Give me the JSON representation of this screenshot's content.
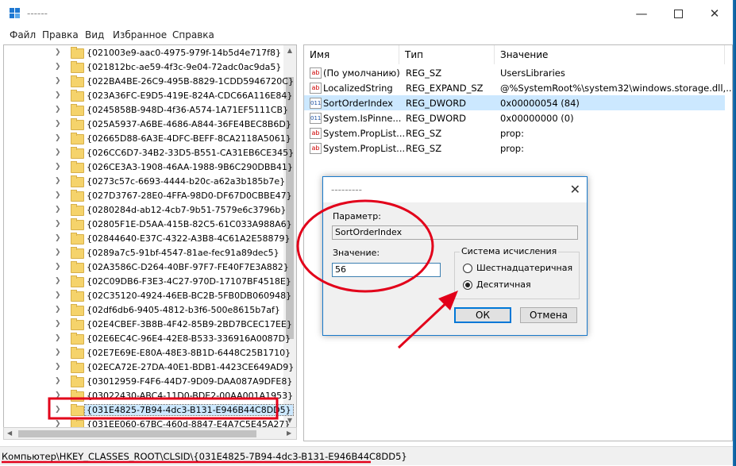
{
  "window": {
    "title": "------",
    "minimize_icon": "minimize-icon",
    "maximize_icon": "maximize-icon",
    "close_icon": "close-icon"
  },
  "menu": [
    "Файл",
    "Правка",
    "Вид",
    "Избранное",
    "Справка"
  ],
  "tree": {
    "items": [
      "{021003e9-aac0-4975-979f-14b5d4e717f8}",
      "{021812bc-ae59-4f3c-9e04-72adc0ac9da5}",
      "{022BA4BE-26C9-495B-8829-1CDD5946720C}",
      "{023A36FC-E9D5-419E-824A-CDC66A116E84}",
      "{0245858B-948D-4f36-A574-1A71EF5111CB}",
      "{025A5937-A6BE-4686-A844-36FE4BEC8B6D}",
      "{02665D88-6A3E-4DFC-BEFF-8CA2118A5061}",
      "{026CC6D7-34B2-33D5-B551-CA31EB6CE345}",
      "{026CE3A3-1908-46AA-1988-9B6C290DBB41}",
      "{0273c57c-6693-4444-b20c-a62a3b185b7e}",
      "{027D3767-28E0-4FFA-98D0-DF67D0CBBE47}",
      "{0280284d-ab12-4cb7-9b51-7579e6c3796b}",
      "{02805F1E-D5AA-415B-82C5-61C033A988A6}",
      "{02844640-E37C-4322-A3B8-4C61A2E58879}",
      "{0289a7c5-91bf-4547-81ae-fec91a89dec5}",
      "{02A3586C-D264-40BF-97F7-FE40F7E3A882}",
      "{02C09DB6-F3E3-4C27-970D-17107BF4518E}",
      "{02C35120-4924-46EB-BC2B-5FB0DB060948}",
      "{02df6db6-9405-4812-b3f6-500e8615b7af}",
      "{02E4CBEF-3B8B-4F42-85B9-2BD7BCEC17EE}",
      "{02E6EC4C-96E4-42E8-B533-336916A0087D}",
      "{02E7E69E-E80A-48E3-8B1D-6448C25B1710}",
      "{02ECA72E-27DA-40E1-BDB1-4423CE649AD9}",
      "{03012959-F4F6-44D7-9D09-DAA087A9DFE8}",
      "{03022430-ABC4-11D0-BDE2-00AA001A1953}",
      "{031E4825-7B94-4dc3-B131-E946B44C8DD5}",
      "{031EE060-67BC-460d-8847-E4A7C5E45A27}"
    ],
    "selected_index": 25
  },
  "values": {
    "columns": [
      "Имя",
      "Тип",
      "Значение"
    ],
    "rows": [
      {
        "name": "(По умолчанию)",
        "type": "REG_SZ",
        "value": "UsersLibraries",
        "icon": "ab"
      },
      {
        "name": "LocalizedString",
        "type": "REG_EXPAND_SZ",
        "value": "@%SystemRoot%\\system32\\windows.storage.dll,...",
        "icon": "ab"
      },
      {
        "name": "SortOrderIndex",
        "type": "REG_DWORD",
        "value": "0x00000054 (84)",
        "icon": "011"
      },
      {
        "name": "System.IsPinne...",
        "type": "REG_DWORD",
        "value": "0x00000000 (0)",
        "icon": "011"
      },
      {
        "name": "System.PropList...",
        "type": "REG_SZ",
        "value": "prop:",
        "icon": "ab"
      },
      {
        "name": "System.PropList...",
        "type": "REG_SZ",
        "value": "prop:",
        "icon": "ab"
      }
    ],
    "selected_index": 2
  },
  "status": "Компьютер\\HKEY_CLASSES_ROOT\\CLSID\\{031E4825-7B94-4dc3-B131-E946B44C8DD5}",
  "dialog": {
    "title": "---------",
    "param_label": "Параметр:",
    "param_value": "SortOrderIndex",
    "value_label": "Значение:",
    "value_value": "56",
    "base_group_label": "Система исчисления",
    "hex_label": "Шестнадцатеричная",
    "dec_label": "Десятичная",
    "selected_base": "dec",
    "ok_label": "ОК",
    "cancel_label": "Отмена"
  },
  "colors": {
    "accent": "#0078d7",
    "selection": "#cce8ff",
    "annotation": "#e2001a"
  }
}
